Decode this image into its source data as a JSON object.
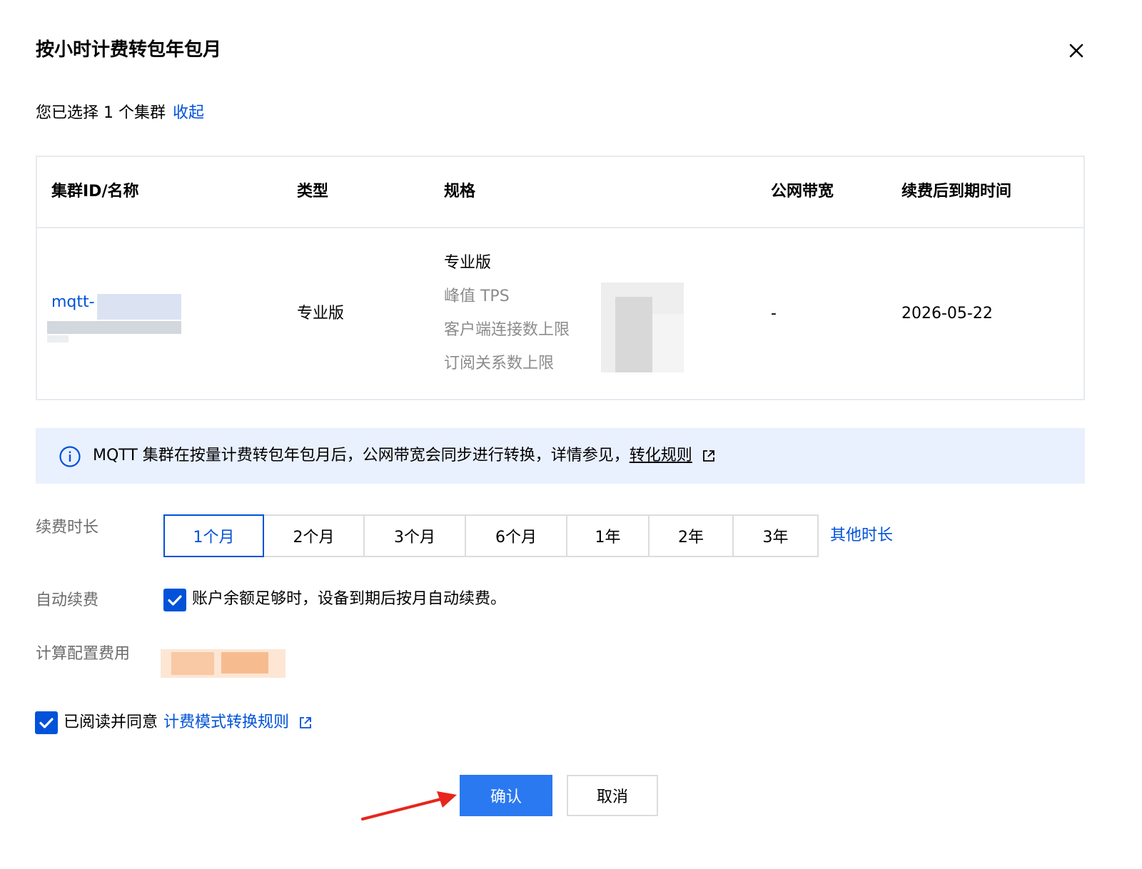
{
  "dialog": {
    "title": "按小时计费转包年包月",
    "close_icon": "close-icon"
  },
  "selection": {
    "summary": "您已选择 1 个集群",
    "collapse_label": "收起"
  },
  "table": {
    "columns": [
      "集群ID/名称",
      "类型",
      "规格",
      "公网带宽",
      "续费后到期时间"
    ],
    "rows": [
      {
        "cluster_id": "mqtt-",
        "type": "专业版",
        "spec_title": "专业版",
        "spec_items": [
          "峰值 TPS",
          "客户端连接数上限",
          "订阅关系数上限"
        ],
        "bandwidth": "-",
        "expire_date": "2026-05-22"
      }
    ]
  },
  "info_banner": {
    "icon": "info-icon",
    "text": "MQTT 集群在按量计费转包年包月后，公网带宽会同步进行转换，详情参见，",
    "link_label": "转化规则",
    "link_icon": "external-link-icon"
  },
  "form": {
    "duration_label": "续费时长",
    "duration_options": [
      "1个月",
      "2个月",
      "3个月",
      "6个月",
      "1年",
      "2年",
      "3年"
    ],
    "duration_selected": "1个月",
    "other_duration_label": "其他时长",
    "auto_renew_label": "自动续费",
    "auto_renew_checked": true,
    "auto_renew_text": "账户余额足够时，设备到期后按月自动续费。",
    "cost_label": "计算配置费用"
  },
  "agreement": {
    "checked": true,
    "text": "已阅读并同意",
    "link_label": "计费模式转换规则",
    "link_icon": "external-link-icon"
  },
  "actions": {
    "confirm_label": "确认",
    "cancel_label": "取消"
  },
  "colors": {
    "primary": "#0052d9",
    "confirm_button": "#2a79f1",
    "banner_bg": "#e9f0fe",
    "annotation_arrow": "#e8251c"
  }
}
